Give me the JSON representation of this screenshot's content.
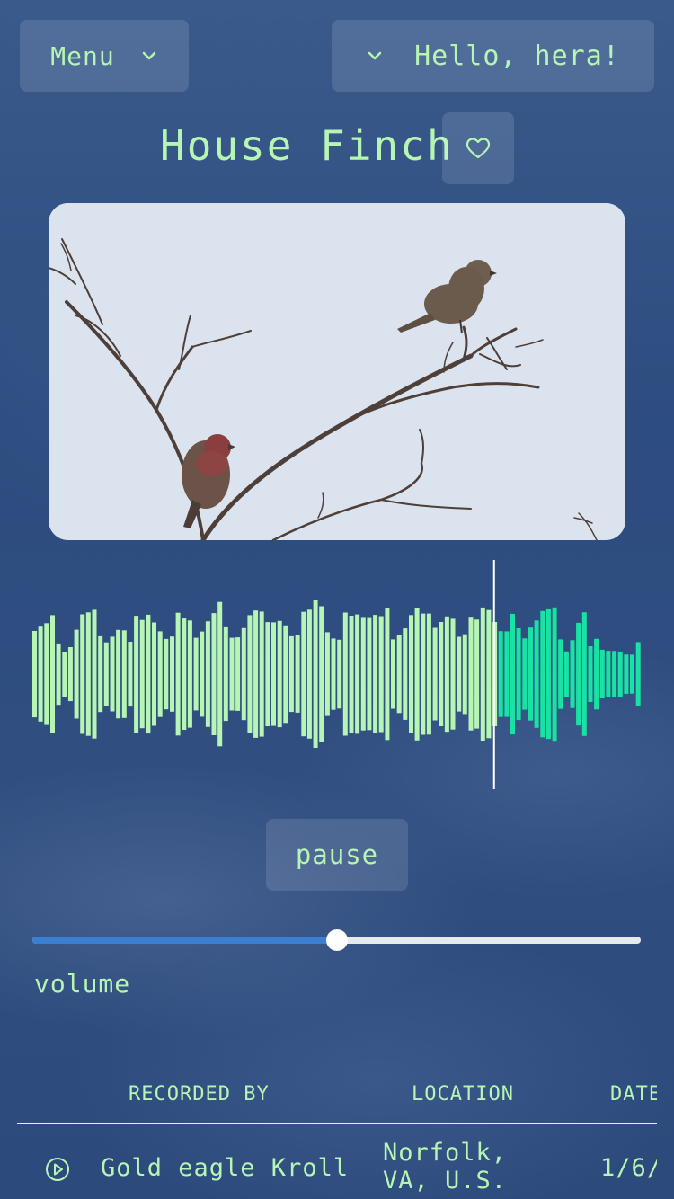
{
  "header": {
    "menu_label": "Menu",
    "greeting": "Hello, hera!"
  },
  "bird": {
    "name": "House Finch"
  },
  "player": {
    "pause_label": "pause",
    "progress": 0.76,
    "volume_label": "volume",
    "volume": 0.5
  },
  "recordings": {
    "columns": [
      "RECORDED BY",
      "LOCATION",
      "DATE"
    ],
    "rows": [
      {
        "recorded_by": "Gold eagle Kroll",
        "location_line1": "Norfolk,",
        "location_line2": "VA, U.S.",
        "date": "1/6/"
      }
    ]
  },
  "colors": {
    "accent": "#b6f5b3",
    "played": "#19e3a4",
    "volume_fill": "#3a7fd1"
  },
  "icons": {
    "menu_chevron": "chevron-down-icon",
    "user_chevron": "chevron-down-icon",
    "favorite": "heart-icon",
    "play": "play-circle-icon"
  }
}
